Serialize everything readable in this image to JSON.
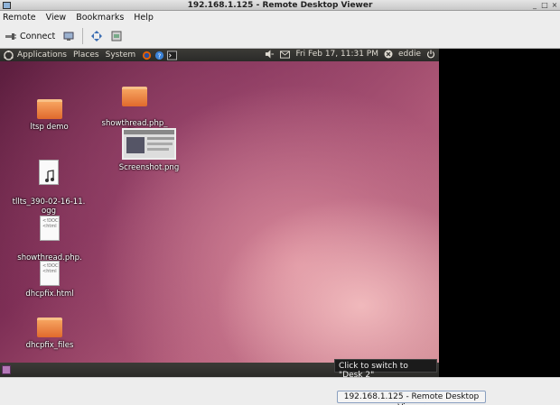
{
  "window": {
    "title": "192.168.1.125 - Remote Desktop Viewer",
    "controls": [
      "_",
      "□",
      "×"
    ]
  },
  "menu": [
    "Remote",
    "View",
    "Bookmarks",
    "Help"
  ],
  "toolbar": {
    "connect_label": "Connect"
  },
  "panel": {
    "menus": [
      "Applications",
      "Places",
      "System"
    ],
    "clock": "Fri Feb 17, 11:31 PM",
    "user": "eddie"
  },
  "desktop_icons": [
    {
      "label": "ltsp demo"
    },
    {
      "label": "tllts_390-02-16-11.\nogg"
    },
    {
      "label": "showthread.php.\nhtml"
    },
    {
      "label": "dhcpfix.html"
    },
    {
      "label": "dhcpfix_files"
    },
    {
      "label": "showthread.php_\nfiles"
    },
    {
      "label": "Screenshot.png"
    }
  ],
  "doc_preview": {
    "html_glyph": "<!DOC\n<html"
  },
  "tooltip": "Click to switch to \"Desk 2\"",
  "taskbar": {
    "window_button": "192.168.1.125 - Remote Desktop Viewer"
  },
  "colors": {
    "panel": "#3c3b37",
    "folder": "#e9793a",
    "wallpaper_dark": "#5a1d3d",
    "wallpaper_light": "#cf8a91"
  }
}
